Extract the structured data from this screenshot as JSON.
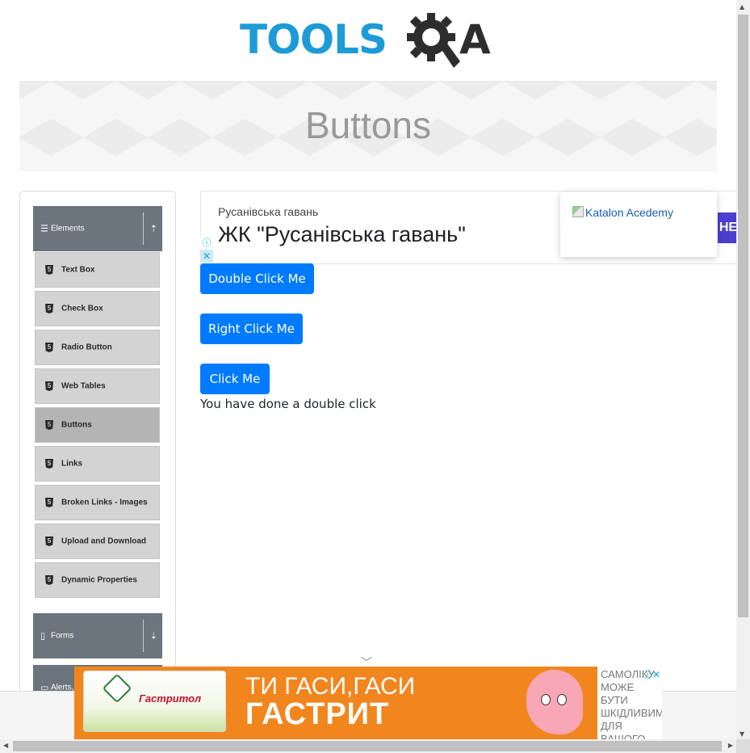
{
  "logo": {
    "part1": "TOOLS",
    "part2": "A"
  },
  "banner": {
    "title": "Buttons"
  },
  "sidebar": {
    "group_elements": {
      "label": "Elements"
    },
    "items": [
      {
        "label": "Text Box",
        "icon": "html5-icon"
      },
      {
        "label": "Check Box",
        "icon": "html5-icon"
      },
      {
        "label": "Radio Button",
        "icon": "html5-icon"
      },
      {
        "label": "Web Tables",
        "icon": "html5-icon"
      },
      {
        "label": "Buttons",
        "icon": "html5-icon",
        "active": true
      },
      {
        "label": "Links",
        "icon": "html5-icon"
      },
      {
        "label": "Broken Links - Images",
        "icon": "html5-icon"
      },
      {
        "label": "Upload and Download",
        "icon": "html5-icon"
      },
      {
        "label": "Dynamic Properties",
        "icon": "html5-icon"
      }
    ],
    "group_forms": {
      "label": "Forms"
    },
    "group_alerts": {
      "label": "Alerts,"
    }
  },
  "ad_top": {
    "subtitle": "Русанівська гавань",
    "title": "ЖК \"Русанівська гавань\"",
    "cta": "НЕ"
  },
  "katalon": {
    "alt": "Katalon Acedemy"
  },
  "buttons": {
    "double_click": "Double Click Me",
    "right_click": "Right Click Me",
    "click": "Click Me"
  },
  "result": "You have done a double click",
  "ad_bottom": {
    "brand": "Гастритол",
    "slogan_line1": "ТИ ГАСИ,ГАСИ",
    "slogan_line2": "ГАСТРИТ",
    "warning": "САМОЛІКУ МОЖЕ БУТИ ШКІДЛИВИМ ДЛЯ ВАШОГО ЗДОРОВ'Я"
  },
  "colors": {
    "primary_button": "#007bff",
    "sidebar_header": "#6c757d",
    "menu_item": "#d3d3d3",
    "menu_item_active": "#b4b4b4",
    "logo_blue": "#1c9bd6",
    "ad_orange": "#f2861e"
  }
}
